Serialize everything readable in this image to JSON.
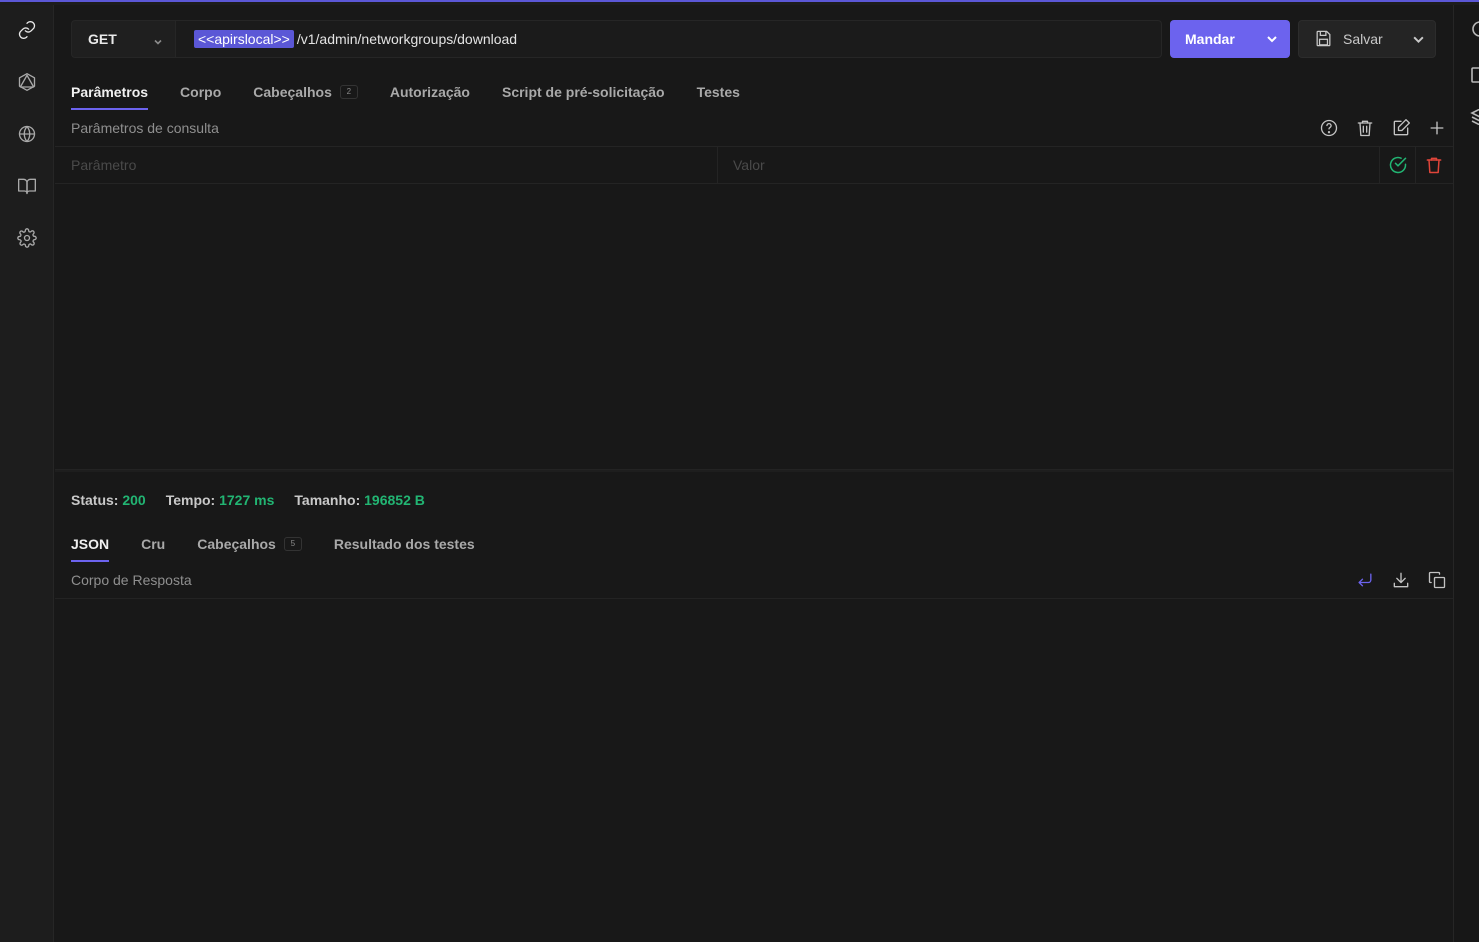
{
  "request": {
    "method": "GET",
    "url_variable": "<<apirslocal>>",
    "url_path": "/v1/admin/networkgroups/download",
    "send_label": "Mandar",
    "save_label": "Salvar"
  },
  "request_tabs": [
    {
      "label": "Parâmetros",
      "active": true
    },
    {
      "label": "Corpo"
    },
    {
      "label": "Cabeçalhos",
      "badge": "2"
    },
    {
      "label": "Autorização"
    },
    {
      "label": "Script de pré-solicitação"
    },
    {
      "label": "Testes"
    }
  ],
  "params": {
    "section_title": "Parâmetros de consulta",
    "key_placeholder": "Parâmetro",
    "value_placeholder": "Valor"
  },
  "response": {
    "status_label": "Status:",
    "status_value": "200",
    "time_label": "Tempo:",
    "time_value": "1727 ms",
    "size_label": "Tamanho:",
    "size_value": "196852 B",
    "tabs": [
      {
        "label": "JSON",
        "active": true
      },
      {
        "label": "Cru"
      },
      {
        "label": "Cabeçalhos",
        "badge": "5"
      },
      {
        "label": "Resultado dos testes"
      }
    ],
    "body_title": "Corpo de Resposta"
  },
  "colors": {
    "accent": "#6c63ee",
    "success": "#22b573",
    "danger": "#e0453a",
    "background": "#181818"
  },
  "icons": {
    "rail": [
      "link-icon",
      "graphql-icon",
      "globe-icon",
      "book-icon",
      "settings-icon"
    ],
    "param_tools": [
      "help-icon",
      "trash-icon",
      "edit-icon",
      "plus-icon"
    ],
    "response_tools": [
      "wrap-lines-icon",
      "download-icon",
      "copy-icon"
    ]
  }
}
